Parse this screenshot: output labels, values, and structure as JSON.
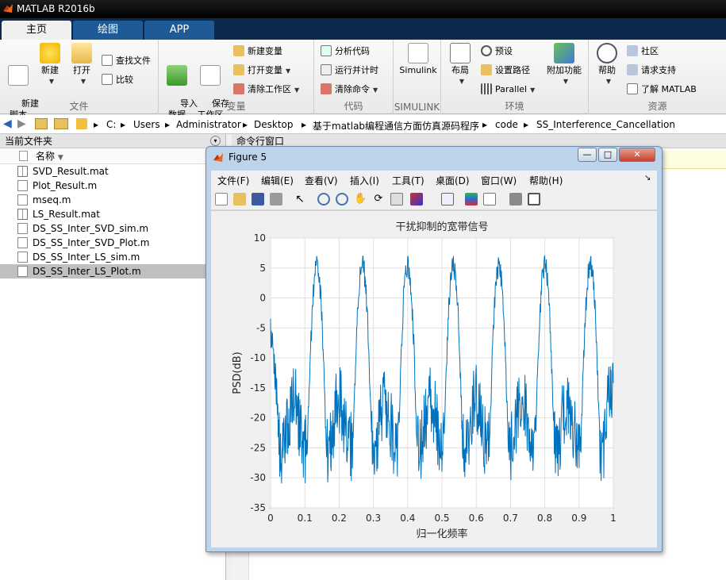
{
  "app": {
    "title": "MATLAB R2016b"
  },
  "tabs": [
    {
      "label": "主页"
    },
    {
      "label": "绘图"
    },
    {
      "label": "APP"
    }
  ],
  "ribbon": {
    "file": {
      "label": "文件",
      "new_script": "新建\n脚本",
      "new": "新建",
      "open": "打开",
      "find_files": "查找文件",
      "compare": "比较"
    },
    "variable": {
      "label": "变量",
      "import": "导入\n数据",
      "save_ws": "保存\n工作区",
      "new_var": "新建变量",
      "open_var": "打开变量",
      "clear_ws": "清除工作区"
    },
    "code": {
      "label": "代码",
      "analyze": "分析代码",
      "run_time": "运行并计时",
      "clear_cmd": "清除命令"
    },
    "simulink": {
      "label": "SIMULINK",
      "btn": "Simulink"
    },
    "env": {
      "label": "环境",
      "layout": "布局",
      "prefs": "预设",
      "set_path": "设置路径",
      "parallel": "Parallel",
      "addons": "附加功能"
    },
    "resources": {
      "label": "资源",
      "help": "帮助",
      "community": "社区",
      "support": "请求支持",
      "learn": "了解 MATLAB"
    }
  },
  "address": {
    "parts": [
      "C:",
      "Users",
      "Administrator",
      "Desktop",
      "基于matlab编程通信方面仿真源码程序",
      "code",
      "SS_Interference_Cancellation"
    ]
  },
  "current_folder": {
    "title": "当前文件夹",
    "column": "名称",
    "files": [
      {
        "name": "SVD_Result.mat",
        "type": "mat"
      },
      {
        "name": "Plot_Result.m",
        "type": "m"
      },
      {
        "name": "mseq.m",
        "type": "m"
      },
      {
        "name": "LS_Result.mat",
        "type": "mat"
      },
      {
        "name": "DS_SS_Inter_SVD_sim.m",
        "type": "m"
      },
      {
        "name": "DS_SS_Inter_SVD_Plot.m",
        "type": "m"
      },
      {
        "name": "DS_SS_Inter_LS_sim.m",
        "type": "m"
      },
      {
        "name": "DS_SS_Inter_LS_Plot.m",
        "type": "m"
      }
    ]
  },
  "command_window": {
    "title": "命令行窗口"
  },
  "figure": {
    "title": "Figure 5",
    "menus": [
      "文件(F)",
      "编辑(E)",
      "查看(V)",
      "插入(I)",
      "工具(T)",
      "桌面(D)",
      "窗口(W)",
      "帮助(H)"
    ]
  },
  "chart_data": {
    "type": "line",
    "title": "干扰抑制的宽带信号",
    "xlabel": "归一化频率",
    "ylabel": "PSD(dB)",
    "xlim": [
      0,
      1
    ],
    "ylim": [
      -35,
      10
    ],
    "xticks": [
      "0",
      "0.1",
      "0.2",
      "0.3",
      "0.4",
      "0.5",
      "0.6",
      "0.7",
      "0.8",
      "0.9",
      "1"
    ],
    "yticks": [
      "10",
      "5",
      "0",
      "-5",
      "-10",
      "-15",
      "-20",
      "-25",
      "-30",
      "-35"
    ],
    "grid": true,
    "color": "#0072bd",
    "peaks_x": [
      0.135,
      0.268,
      0.4,
      0.533,
      0.666,
      0.8,
      0.933
    ],
    "peak_level_db": 5.5,
    "floor_level_db": -21,
    "min_db": -31.5,
    "start_db": -5,
    "end_db": -15
  }
}
